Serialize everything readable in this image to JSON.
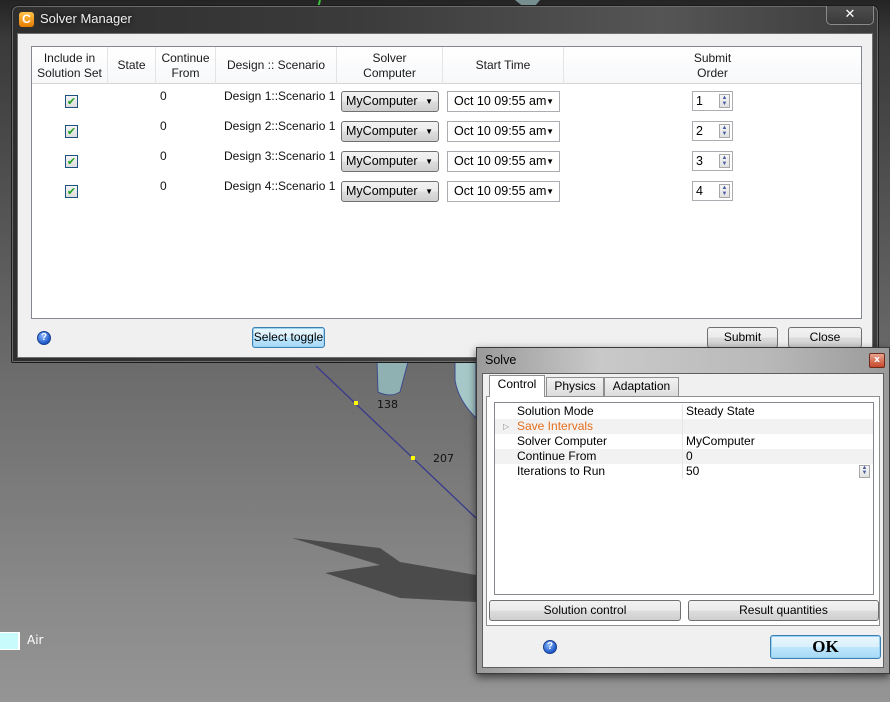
{
  "viewport": {
    "labels": [
      "138",
      "207"
    ],
    "legend": {
      "label": "Air",
      "color": "#c8fbfb"
    }
  },
  "solver_manager": {
    "title": "Solver Manager",
    "close_label": "✕",
    "columns": [
      "Include in\nSolution Set",
      "State",
      "Continue\nFrom",
      "Design :: Scenario",
      "Solver\nComputer",
      "Start Time",
      "Submit\nOrder"
    ],
    "rows": [
      {
        "included": true,
        "state": "",
        "continue_from": "0",
        "design_scenario": "Design 1::Scenario 1",
        "solver_computer": "MyComputer",
        "start_time": "Oct 10 09:55 am",
        "submit_order": "1"
      },
      {
        "included": true,
        "state": "",
        "continue_from": "0",
        "design_scenario": "Design 2::Scenario 1",
        "solver_computer": "MyComputer",
        "start_time": "Oct 10 09:55 am",
        "submit_order": "2"
      },
      {
        "included": true,
        "state": "",
        "continue_from": "0",
        "design_scenario": "Design 3::Scenario 1",
        "solver_computer": "MyComputer",
        "start_time": "Oct 10 09:55 am",
        "submit_order": "3"
      },
      {
        "included": true,
        "state": "",
        "continue_from": "0",
        "design_scenario": "Design 4::Scenario 1",
        "solver_computer": "MyComputer",
        "start_time": "Oct 10 09:55 am",
        "submit_order": "4"
      }
    ],
    "buttons": {
      "select_toggle": "Select toggle",
      "submit": "Submit",
      "close": "Close"
    },
    "help_icon": "?"
  },
  "solve_dialog": {
    "title": "Solve",
    "close_label": "x",
    "tabs": [
      "Control",
      "Physics",
      "Adaptation"
    ],
    "active_tab": "Control",
    "properties": [
      {
        "name": "Solution Mode",
        "value": "Steady State"
      },
      {
        "name": "Save Intervals",
        "value": "",
        "expandable": true,
        "highlight_color": "#e46e1d"
      },
      {
        "name": "Solver Computer",
        "value": "MyComputer"
      },
      {
        "name": "Continue From",
        "value": "0"
      },
      {
        "name": "Iterations to Run",
        "value": "50"
      }
    ],
    "buttons": {
      "solution_control": "Solution control",
      "result_quantities": "Result quantities",
      "ok": "OK"
    },
    "help_icon": "?"
  },
  "glyphs": {
    "check": "✔",
    "dropdown": "▼",
    "spin": "▲\n▼",
    "expander": "▷",
    "app_icon": "C"
  }
}
